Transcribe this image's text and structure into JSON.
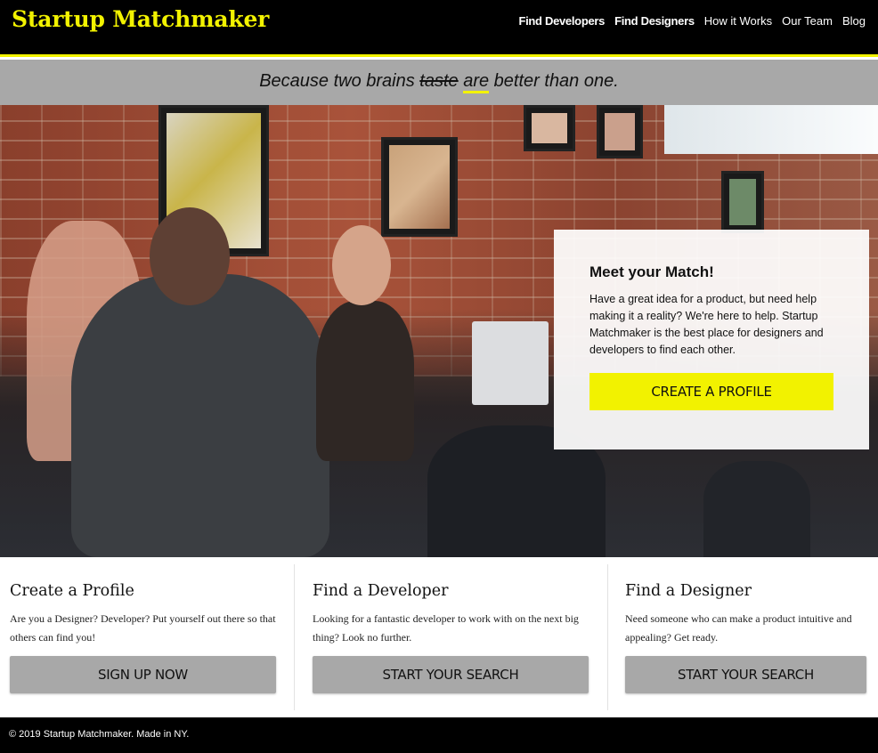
{
  "header": {
    "brand": "Startup Matchmaker",
    "nav": [
      {
        "label": "Find Developers"
      },
      {
        "label": "Find Designers"
      },
      {
        "label": "How it Works"
      },
      {
        "label": "Our Team"
      },
      {
        "label": "Blog"
      }
    ]
  },
  "tagline": {
    "pre": "Because two brains ",
    "struck": "taste",
    "highlight": "are",
    "post": " better than one."
  },
  "hero": {
    "card_title": "Meet your Match!",
    "card_text": "Have a great idea for a product, but need help making it a reality? We're here to help. Startup Matchmaker is the best place for designers and developers to find each other.",
    "cta_label": "CREATE A PROFILE"
  },
  "features": [
    {
      "title": "Create a Profile",
      "text": "Are you a Designer? Developer? Put yourself out there so that others can find you!",
      "button": "SIGN UP NOW"
    },
    {
      "title": "Find a Developer",
      "text": "Looking for a fantastic developer to work with on the next big thing? Look no further.",
      "button": "START YOUR SEARCH"
    },
    {
      "title": "Find a Designer",
      "text": "Need someone who can make a product intuitive and appealing? Get ready.",
      "button": "START YOUR SEARCH"
    }
  ],
  "footer": {
    "copyright": "© 2019 Startup Matchmaker. Made in NY."
  },
  "colors": {
    "accent": "#f2f200",
    "header_bg": "#000000",
    "tagline_bg": "#a8a8a8",
    "button_bg": "#a8a8a8"
  }
}
